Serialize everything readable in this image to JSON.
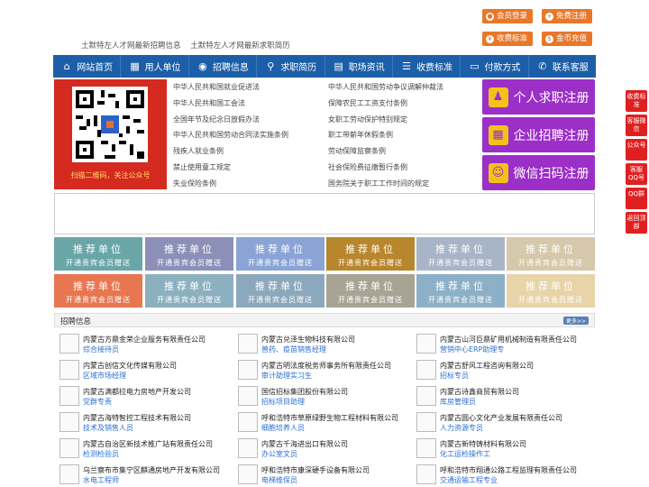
{
  "top_buttons": [
    {
      "label": "会员登录",
      "icon": "user-icon"
    },
    {
      "label": "免费注册",
      "icon": "user-plus-icon"
    },
    {
      "label": "收费标准",
      "icon": "yen-icon"
    },
    {
      "label": "金币充值",
      "icon": "coin-icon"
    }
  ],
  "sub_links": [
    "土默特左人才网最新招聘信息",
    "土默特左人才网最新求职简历"
  ],
  "nav": [
    {
      "label": "网站首页",
      "icon": "home-icon"
    },
    {
      "label": "用人单位",
      "icon": "building-icon"
    },
    {
      "label": "招聘信息",
      "icon": "broadcast-icon"
    },
    {
      "label": "求职简历",
      "icon": "search-icon"
    },
    {
      "label": "职场资讯",
      "icon": "news-icon"
    },
    {
      "label": "收费标准",
      "icon": "list-icon"
    },
    {
      "label": "付款方式",
      "icon": "card-icon"
    },
    {
      "label": "联系客服",
      "icon": "phone-icon"
    }
  ],
  "qr": {
    "caption": "扫描二维码，关注公众号"
  },
  "laws": [
    [
      "中华人民共和国就业促进法",
      "中华人民共和国劳动争议调解仲裁法"
    ],
    [
      "中华人民共和国工会法",
      "保障农民工工资支付条例"
    ],
    [
      "全国年节及纪念日放假办法",
      "女职工劳动保护特别规定"
    ],
    [
      "中华人民共和国劳动合同法实施条例",
      "职工带薪年休假条例"
    ],
    [
      "残疾人就业条例",
      "劳动保障监察条例"
    ],
    [
      "禁止使用童工规定",
      "社会保险费征缴暂行条例"
    ],
    [
      "失业保险条例",
      "国务院关于职工工作时间的规定"
    ]
  ],
  "register": [
    {
      "label": "个人求职注册",
      "icon": "person-icon"
    },
    {
      "label": "企业招聘注册",
      "icon": "company-icon"
    },
    {
      "label": "微信扫码注册",
      "icon": "wechat-icon"
    }
  ],
  "ads": {
    "line1": "推荐单位",
    "line2": "开通贵宾会员赠送",
    "colors": [
      "#6aa6a8",
      "#8c90b8",
      "#8aa4d6",
      "#b8862c",
      "#a8b4c8",
      "#d6c8aa",
      "#e87650",
      "#8cb0c0",
      "#8ca8bc",
      "#a8a494",
      "#8cb0c8",
      "#e8d4a8"
    ]
  },
  "jobs": {
    "title": "招聘信息",
    "more": "更多>>",
    "items": [
      {
        "company": "内蒙古方鼎金荣企业服务有限责任公司",
        "position": "综合接待员"
      },
      {
        "company": "内蒙古兑泽生物科技有限公司",
        "position": "兽药、疫苗销售经理"
      },
      {
        "company": "内蒙古山河巨鼎矿用机械制造有限责任公司",
        "position": "营销中心ERP助理专"
      },
      {
        "company": "内蒙古创信文化传媒有限公司",
        "position": "区域市场经理"
      },
      {
        "company": "内蒙古明法度税务师事务所有限责任公司",
        "position": "审计助理实习生"
      },
      {
        "company": "内蒙古舒风工程咨询有限公司",
        "position": "招标专员"
      },
      {
        "company": "内蒙古满都拉电力房地产开发公司",
        "position": "党群专责"
      },
      {
        "company": "国信招标集团股份有限公司",
        "position": "招标项目助理"
      },
      {
        "company": "内蒙古诗鑫商贸有限公司",
        "position": "库房管理员"
      },
      {
        "company": "内蒙古海特智控工程技术有限公司",
        "position": "技术及销售人员"
      },
      {
        "company": "呼和浩特市草原绿野生物工程材料有限公司",
        "position": "细胞培养人员"
      },
      {
        "company": "内蒙古圆心文化产业发展有限责任公司",
        "position": "人力资源专员"
      },
      {
        "company": "内蒙古自治区新技术推广站有限责任公司",
        "position": "检测检验员"
      },
      {
        "company": "内蒙古千海进出口有限公司",
        "position": "办公室文员"
      },
      {
        "company": "内蒙古新特铸材料有限公司",
        "position": "化工运检操作工"
      },
      {
        "company": "乌兰察布市集宁区麒通房地产开发有限公司",
        "position": "水电工程师"
      },
      {
        "company": "呼和浩特市康深硬手设备有限公司",
        "position": "电梯维保员"
      },
      {
        "company": "呼和浩特市翔通公路工程监理有限责任公司",
        "position": "交通运输工程专业"
      }
    ]
  },
  "float_bar": [
    "收费标准",
    "客服微信",
    "公众号",
    "客服QQ号",
    "QQ群",
    "返回顶部"
  ]
}
